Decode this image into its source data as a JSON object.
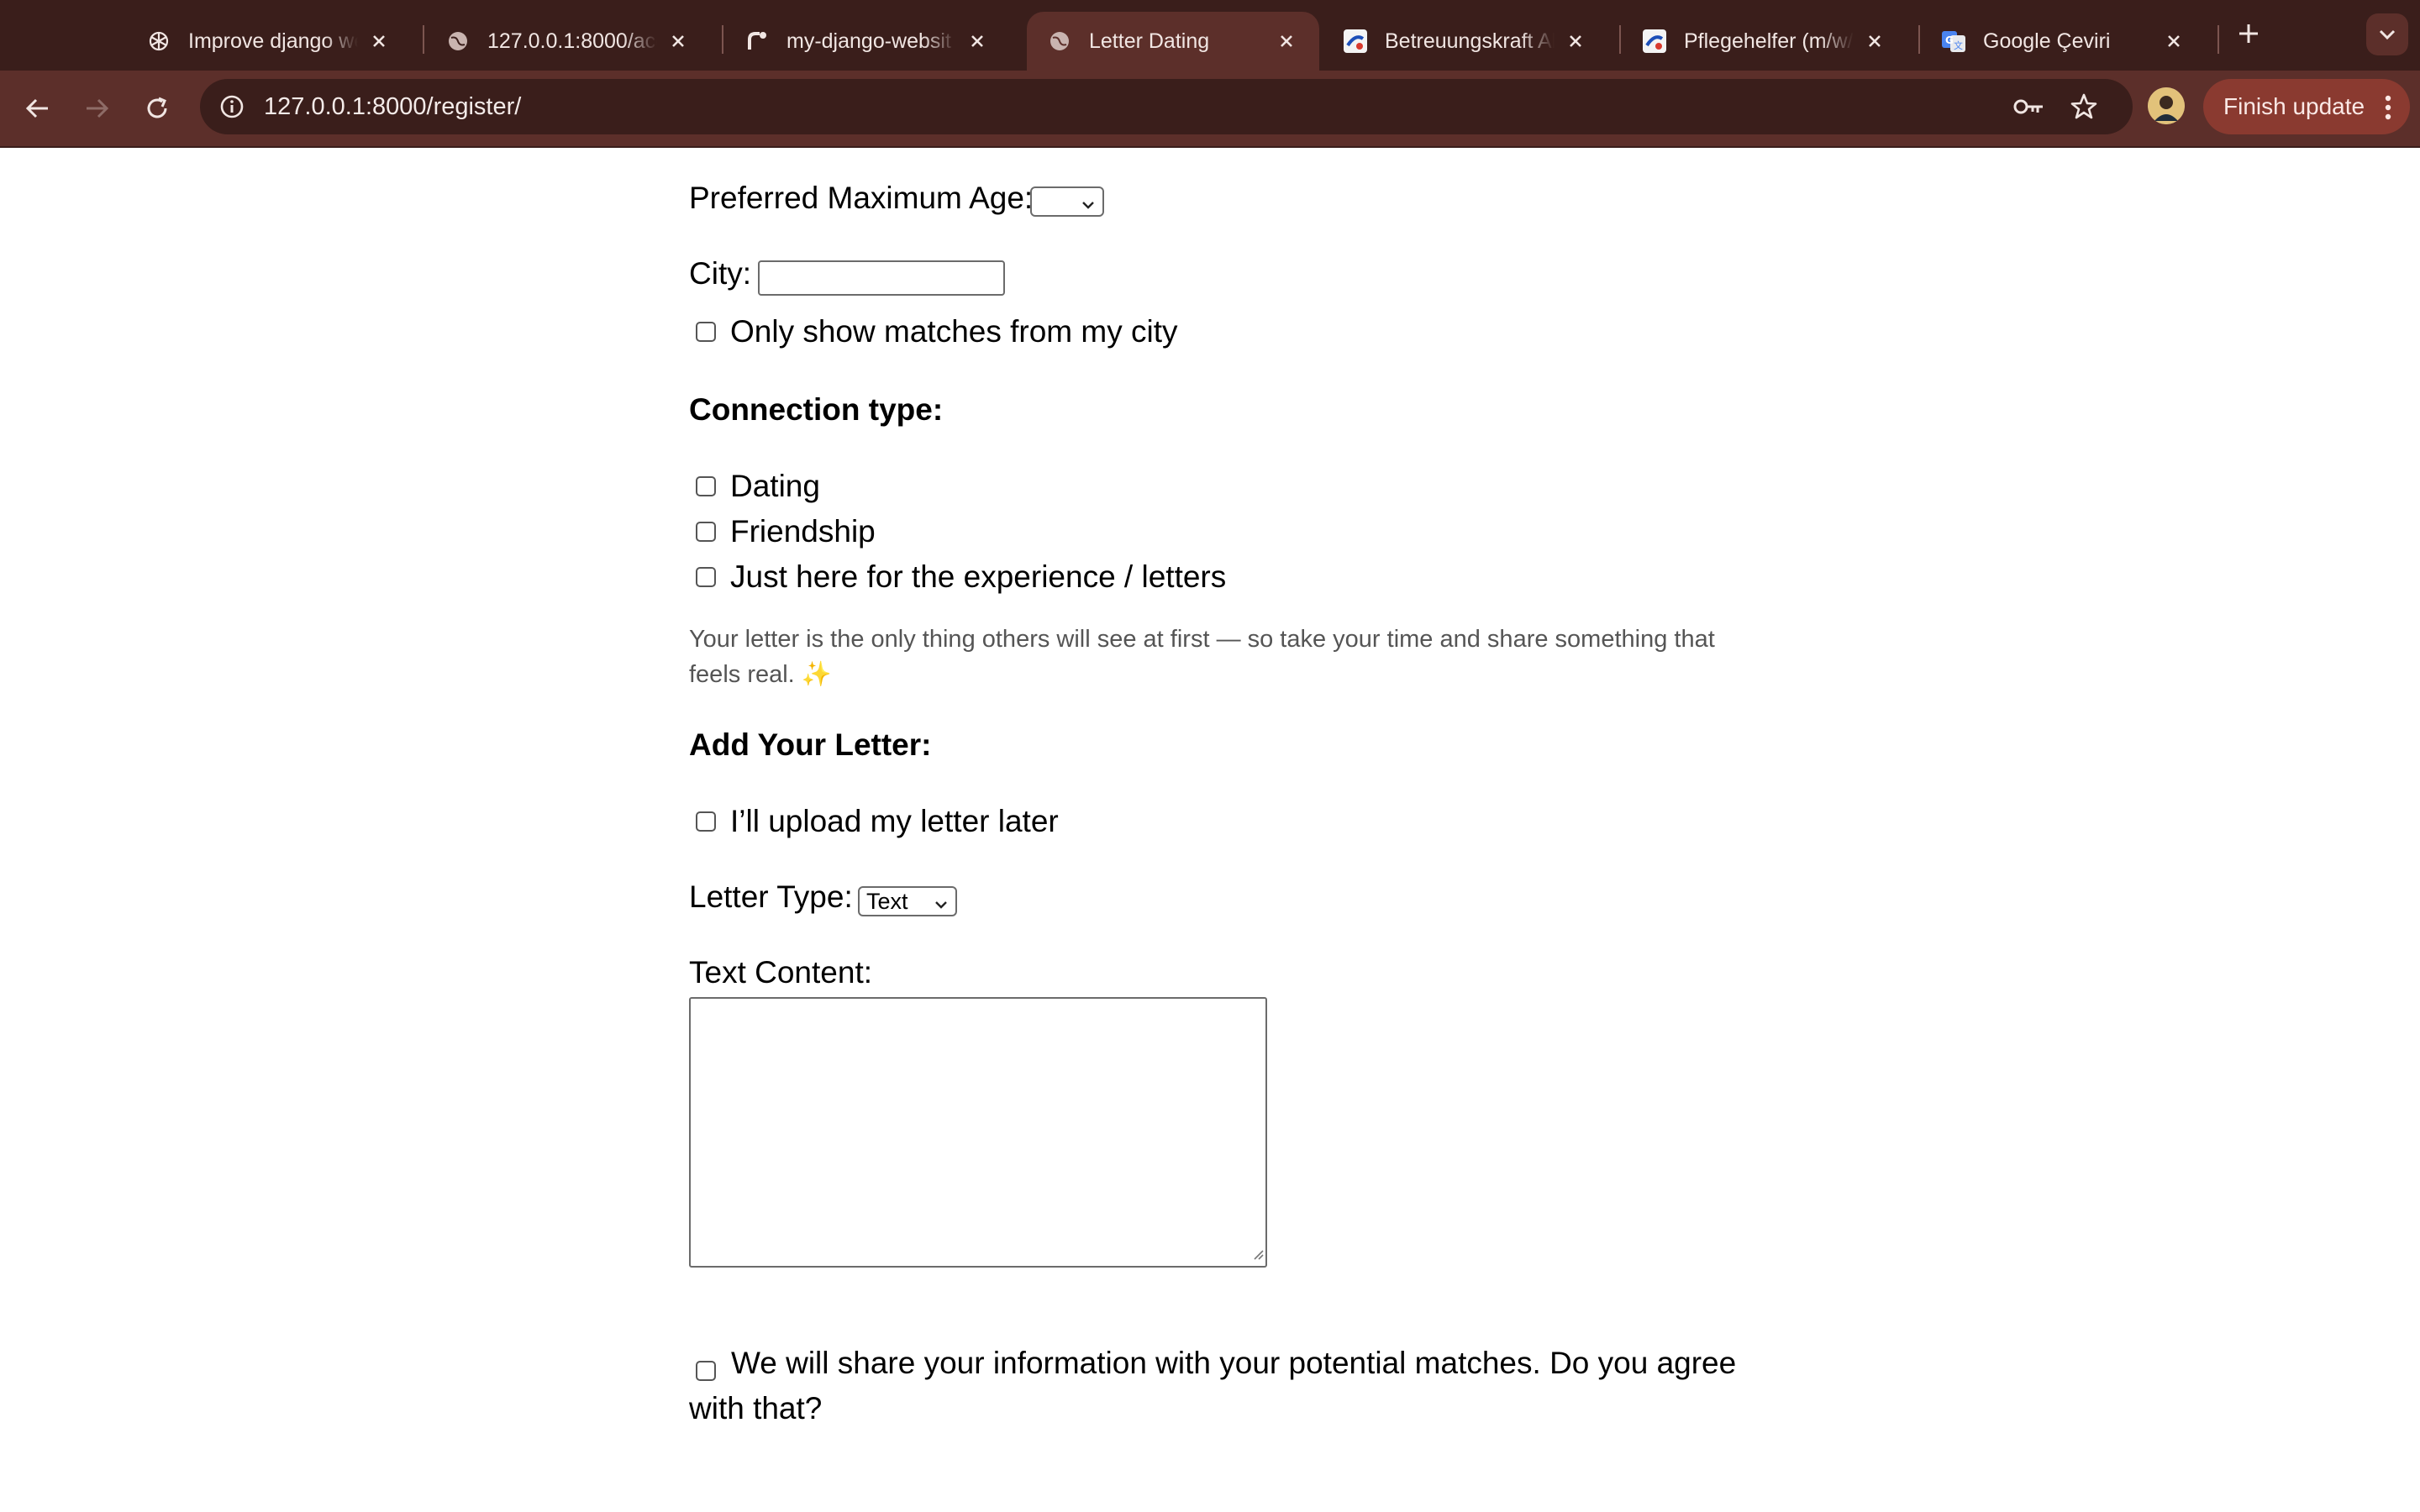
{
  "browser": {
    "tabs": [
      {
        "title": "Improve django we",
        "favicon": "chatgpt-icon",
        "active": false
      },
      {
        "title": "127.0.0.1:8000/acc",
        "favicon": "globe-icon",
        "active": false
      },
      {
        "title": "my-django-websit",
        "favicon": "render-icon",
        "active": false
      },
      {
        "title": "Letter Dating",
        "favicon": "globe-icon",
        "active": true
      },
      {
        "title": "Betreuungskraft Al",
        "favicon": "job-site-icon",
        "active": false
      },
      {
        "title": "Pflegehelfer (m/w/d",
        "favicon": "job-site-icon",
        "active": false
      },
      {
        "title": "Google Çeviri",
        "favicon": "google-translate-icon",
        "active": false
      }
    ],
    "url": "127.0.0.1:8000/register/",
    "finish_update_label": "Finish update",
    "colors": {
      "frame": "#3a1e1b",
      "toolbar": "#5c2f2a",
      "update_button": "#8a3a30"
    }
  },
  "form": {
    "max_age_label": "Preferred Maximum Age:",
    "max_age_value": "",
    "city_label": "City:",
    "city_value": "",
    "only_city_label": "Only show matches from my city",
    "connection_heading": "Connection type:",
    "connection_options": [
      "Dating",
      "Friendship",
      "Just here for the experience / letters"
    ],
    "hint_text": "Your letter is the only thing others will see at first — so take your time and share something that feels real.",
    "hint_emoji": "✨",
    "letter_heading": "Add Your Letter:",
    "upload_later_label": "I’ll upload my letter later",
    "letter_type_label": "Letter Type:",
    "letter_type_value": "Text",
    "text_content_label": "Text Content:",
    "text_content_value": "",
    "agree_label": "We will share your information with your potential matches. Do you agree with that?"
  }
}
